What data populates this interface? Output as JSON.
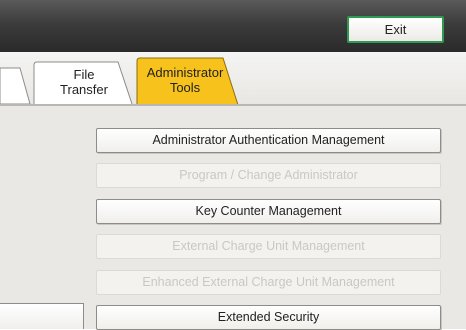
{
  "header": {
    "exit_label": "Exit"
  },
  "tabs": [
    {
      "label_line1": "File",
      "label_line2": "Transfer",
      "active": false
    },
    {
      "label_line1": "Administrator",
      "label_line2": "Tools",
      "active": true
    }
  ],
  "menu": [
    {
      "label": "Administrator Authentication Management",
      "enabled": true
    },
    {
      "label": "Program / Change Administrator",
      "enabled": false
    },
    {
      "label": "Key Counter Management",
      "enabled": true
    },
    {
      "label": "External Charge Unit Management",
      "enabled": false
    },
    {
      "label": "Enhanced External Charge Unit Management",
      "enabled": false
    },
    {
      "label": "Extended Security",
      "enabled": true
    }
  ],
  "colors": {
    "active_tab": "#f7c21c",
    "exit_border": "#2f9a52"
  }
}
